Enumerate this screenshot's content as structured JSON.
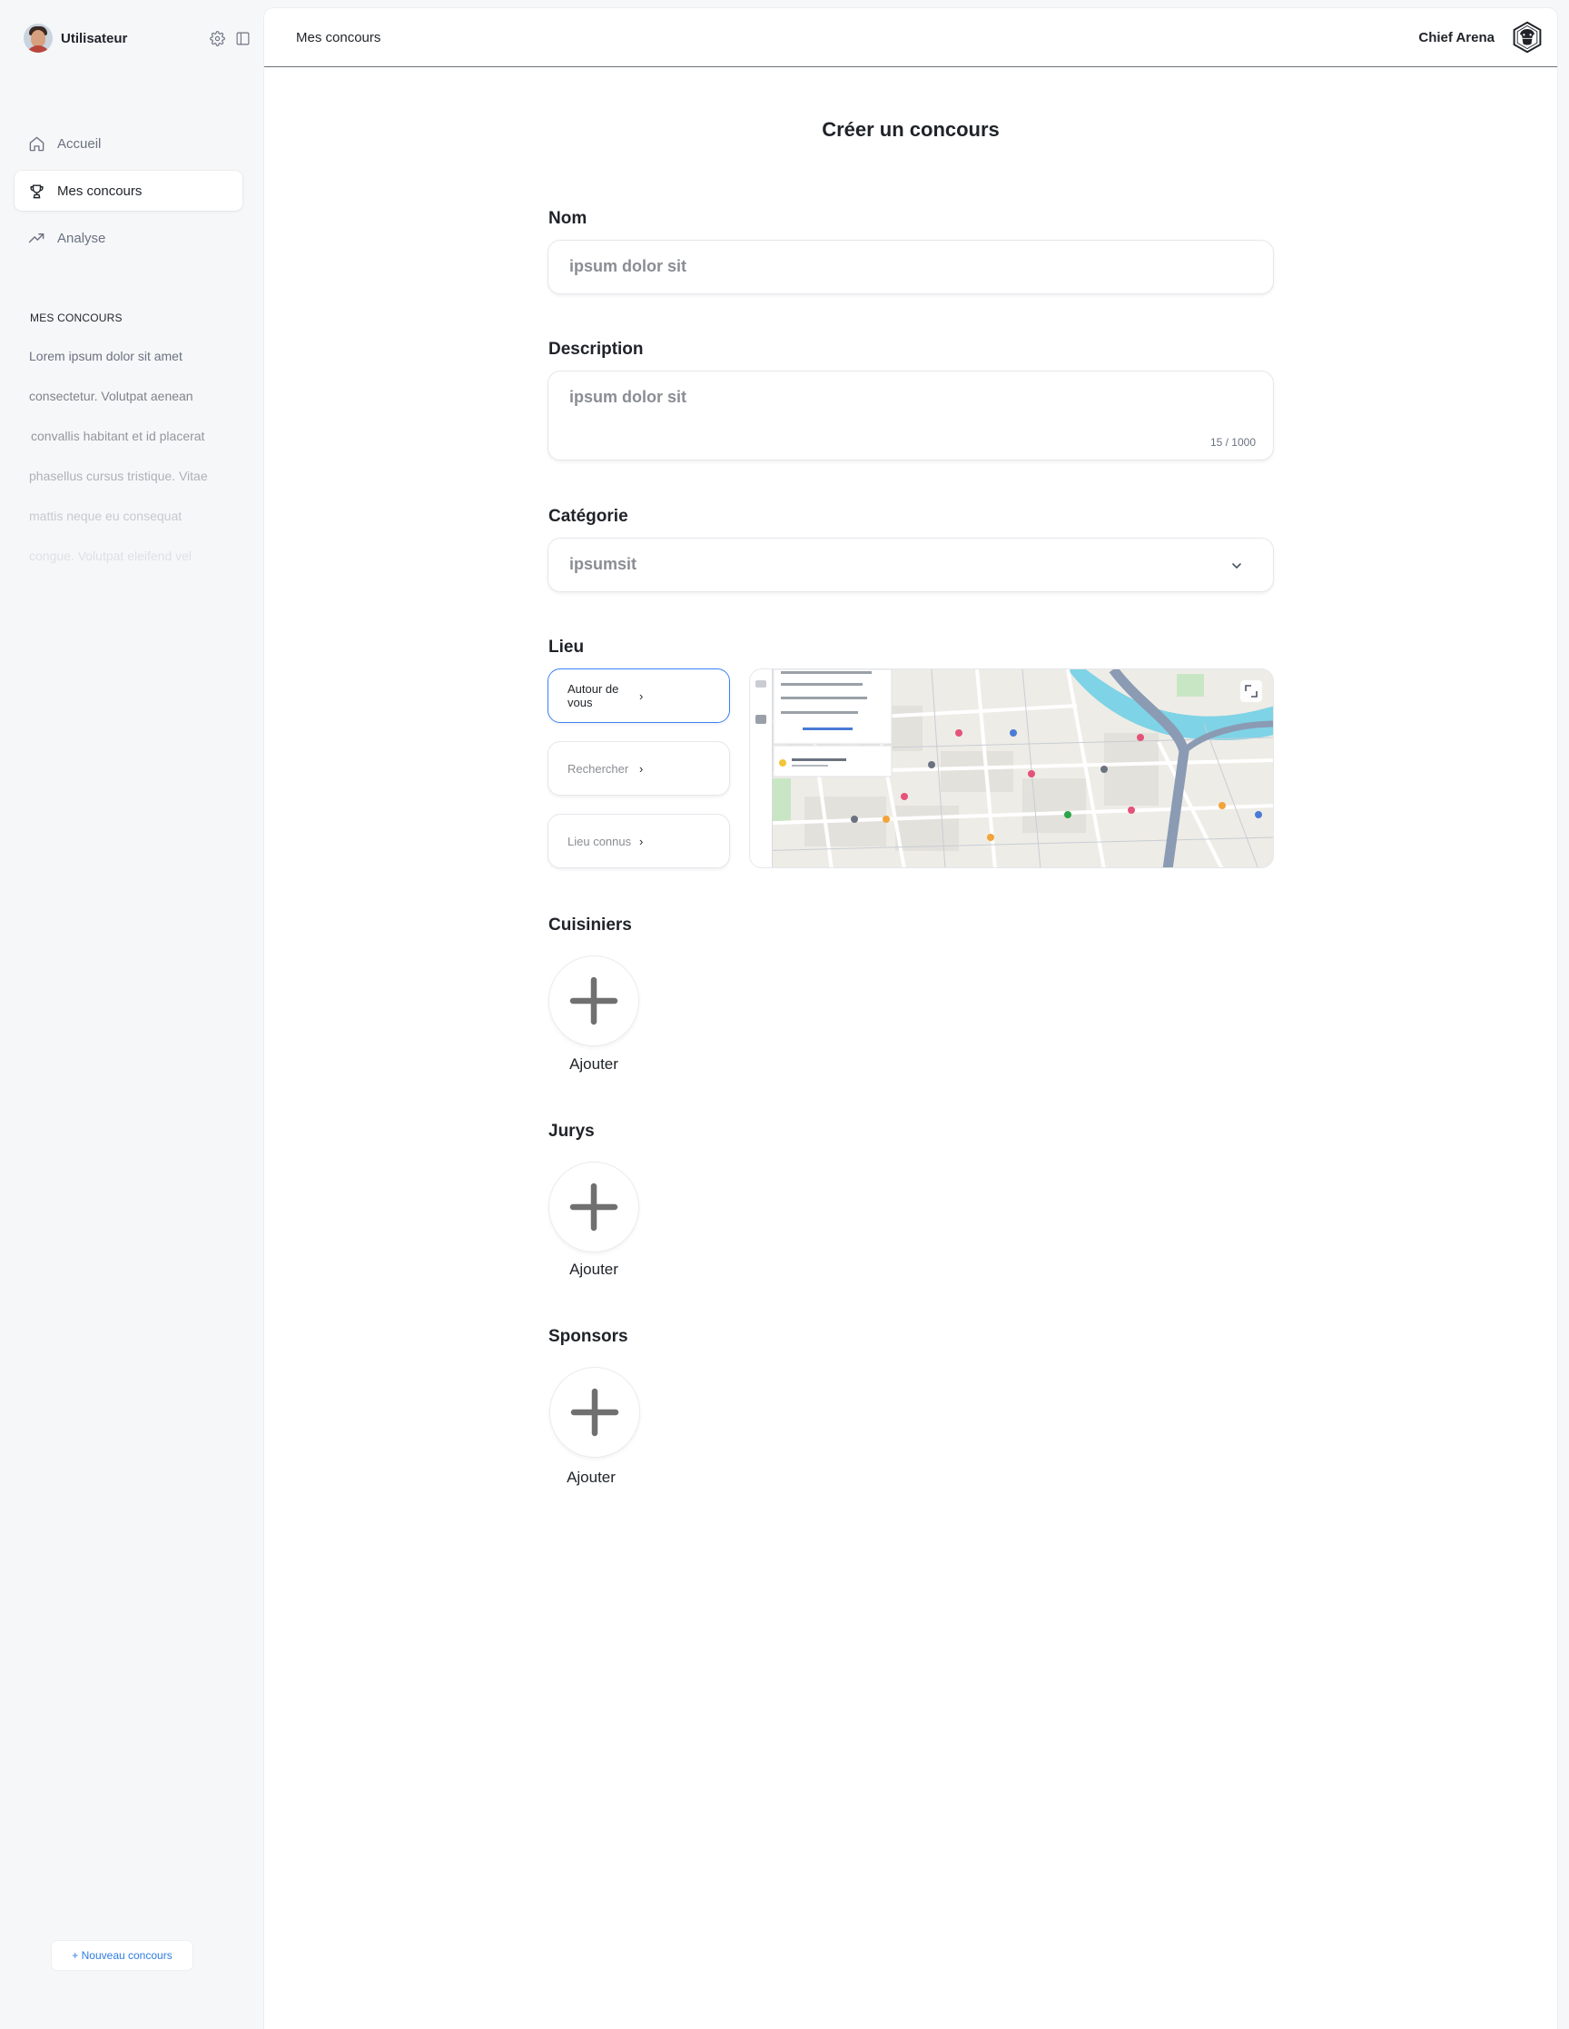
{
  "sidebar": {
    "user_name": "Utilisateur",
    "nav": [
      {
        "label": "Accueil",
        "icon": "home-icon"
      },
      {
        "label": "Mes concours",
        "icon": "trophy-icon",
        "active": true
      },
      {
        "label": "Analyse",
        "icon": "trending-up-icon"
      }
    ],
    "section_title": "MES CONCOURS",
    "concours": [
      "Lorem ipsum dolor sit amet",
      "consectetur. Volutpat aenean",
      "convallis habitant et id placerat",
      "phasellus cursus tristique. Vitae",
      "mattis neque eu consequat",
      "congue. Volutpat eleifend vel"
    ],
    "new_button": "+ Nouveau concours"
  },
  "header": {
    "breadcrumb": "Mes concours",
    "brand": "Chief Arena"
  },
  "form": {
    "title": "Créer un concours",
    "nom": {
      "label": "Nom",
      "value": "ipsum dolor sit"
    },
    "description": {
      "label": "Description",
      "value": "ipsum dolor sit",
      "counter": "15 / 1000"
    },
    "categorie": {
      "label": "Catégorie",
      "value": "ipsumsit"
    },
    "lieu": {
      "label": "Lieu",
      "options": [
        "Autour de vous",
        "Rechercher",
        "Lieu connus"
      ],
      "selected": "Autour de vous"
    },
    "cuisiniers": {
      "label": "Cuisiniers",
      "add": "Ajouter"
    },
    "jurys": {
      "label": "Jurys",
      "add": "Ajouter"
    },
    "sponsors": {
      "label": "Sponsors",
      "add": "Ajouter"
    }
  },
  "colors": {
    "accent": "#3b82f6",
    "link": "#2f7de1",
    "sidebar_bg": "#f6f7f9",
    "river": "#7fd3e6"
  }
}
